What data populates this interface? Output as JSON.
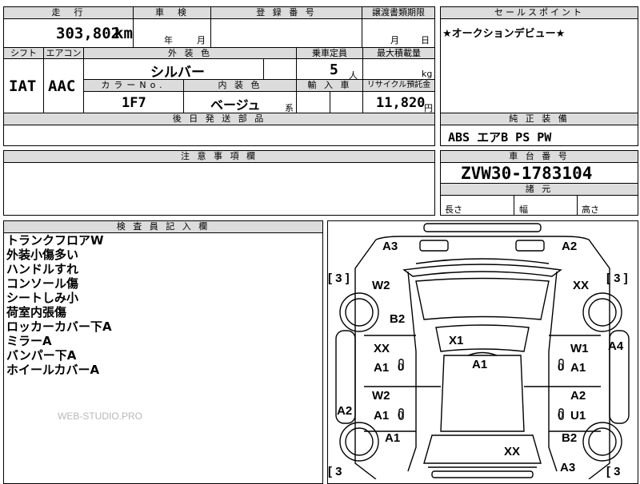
{
  "header": {
    "mileage_label": "走　行",
    "inspection_label": "車　検",
    "registration_label": "登 録 番 号",
    "transfer_deadline_label": "譲渡書類期限",
    "sales_point_label": "セールスポイント",
    "shift_label": "シフト",
    "aircon_label": "エアコン",
    "exterior_color_label": "外 装 色",
    "capacity_label": "乗車定員",
    "max_load_label": "最大積載量",
    "color_no_label": "カラーNo.",
    "interior_color_label": "内 装 色",
    "import_label": "輸 入 車",
    "recycle_label": "リサイクル預託金",
    "parts_label": "後 日 発 送 部 品",
    "options_label": "純 正 装 備",
    "notes_label": "注 意 事 項 欄",
    "chassis_label": "車 台 番 号",
    "dims_label": "諸 元",
    "inspector_label": "検 査 員 記 入 欄"
  },
  "values": {
    "mileage": "303,802",
    "mileage_unit": "km",
    "inspection_year_unit": "年",
    "inspection_month_unit": "月",
    "deadline_month_unit": "月",
    "deadline_day_unit": "日",
    "sales_point": "★オークションデビュー★",
    "shift": "IAT",
    "aircon": "AAC",
    "exterior_color": "シルバー",
    "capacity": "5",
    "capacity_unit": "人",
    "max_load_unit": "kg",
    "color_no": "1F7",
    "interior_color": "ベージュ",
    "interior_color_suffix": "系",
    "recycle_fee": "11,820",
    "recycle_unit": "円",
    "options": "ABS エアB PS PW",
    "chassis_no": "ZVW30-1783104",
    "length_label": "長さ",
    "width_label": "幅",
    "height_label": "高さ"
  },
  "inspector_notes": [
    "トランクフロアW",
    "外装小傷多い",
    "ハンドルすれ",
    "コンソール傷",
    "シートしみ小",
    "荷室内張傷",
    "ロッカーカバー下A",
    "ミラーA",
    "バンパー下A",
    "ホイールカバーA"
  ],
  "watermark": "WEB-STUDIO.PRO",
  "diagram": {
    "bracket_tl": "[ 3 ]",
    "bracket_tr": "[ 3 ]",
    "bracket_bl": "[ 3",
    "bracket_br": "[ 3",
    "codes": {
      "a3_top": "A3",
      "a2_top": "A2",
      "w2_upper": "W2",
      "xx_upper_right": "XX",
      "b2_left": "B2",
      "x1_center": "X1",
      "xx_left_door": "XX",
      "a1_left_door": "A1",
      "a1_center": "A1",
      "w1_right_door": "W1",
      "a1_right_door": "A1",
      "a4_right": "A4",
      "w2_left_rear": "W2",
      "a1_left_rear": "A1",
      "a2_right_rear": "A2",
      "u1_right_rear": "U1",
      "a2_left": "A2",
      "a1_left_lower": "A1",
      "b2_right_lower": "B2",
      "xx_bottom": "XX",
      "a3_bottom": "A3",
      "zero_1": "0",
      "zero_2": "0",
      "zero_3": "0",
      "zero_4": "0"
    }
  }
}
